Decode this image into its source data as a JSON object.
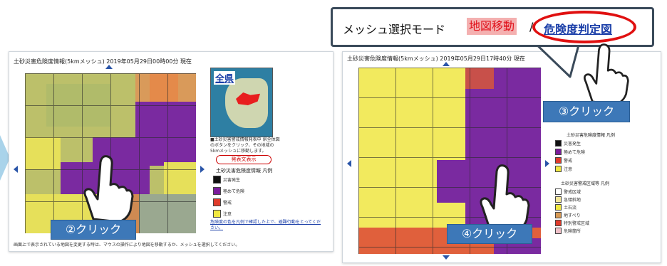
{
  "left": {
    "title": "土砂災害危険度情報(5kmメッシュ) 2019年05月29日00時00分 現在",
    "overview_label": "全県",
    "note": "■土砂災害警戒情報発表中 県全体図のボタンをクリック、その地域の5kmメッシュに移動します。",
    "text_button": "発表文表示",
    "legend_title": "土砂災害危険度情報 凡例",
    "legend": [
      {
        "name": "災害発生",
        "color": "#111111"
      },
      {
        "name": "極めて危険",
        "color": "#7a1c9c"
      },
      {
        "name": "警戒",
        "color": "#e03b2b"
      },
      {
        "name": "注意",
        "color": "#f0e840"
      }
    ],
    "footer": "危険度の色を凡例で確認した上で、避難行動をとってください。",
    "bottom_note": "画面上で表示されている地図を変更する時は、マウスの操作により地図を移動するか、メッシュを選択してください。",
    "badge": "②クリック"
  },
  "right": {
    "title": "土砂災害危険度情報(5kmメッシュ) 2019年05月29日17時40分 現在",
    "mode_label": "メッシュ選択モード",
    "mode_map_move": "地図移動",
    "mode_sep": "/",
    "mode_danger_map": "危険度判定図",
    "legend_title": "土砂災害危険度情報 凡例",
    "legend": [
      {
        "name": "災害発生",
        "color": "#111111"
      },
      {
        "name": "極めて危険",
        "color": "#7a1c9c"
      },
      {
        "name": "警戒",
        "color": "#e03b2b"
      },
      {
        "name": "注意",
        "color": "#f0e840"
      }
    ],
    "legend2_title": "土砂災害警戒区域等 凡例",
    "legend2": [
      {
        "name": "警戒区域",
        "color": "#ffffff"
      },
      {
        "name": "急傾斜地",
        "color": "#f3e69a"
      },
      {
        "name": "土石流",
        "color": "#f0e840"
      },
      {
        "name": "地すべり",
        "color": "#d89a55"
      },
      {
        "name": "特別警戒区域",
        "color": "#e03b2b"
      },
      {
        "name": "危険箇所",
        "color": "#f0c0c8"
      }
    ],
    "badge3": "③クリック",
    "badge4": "④クリック"
  },
  "colors": {
    "purple": "#7a2aa0",
    "yellow": "#efe65c",
    "olive": "#bcc06a",
    "orange": "#e48a4a",
    "pink_mode": "#f4b0b0",
    "link_blue": "#1a3ea8",
    "highlight_red": "#e01010",
    "badge_blue": "#3d78b8",
    "callout_border": "#3a4a5a"
  }
}
